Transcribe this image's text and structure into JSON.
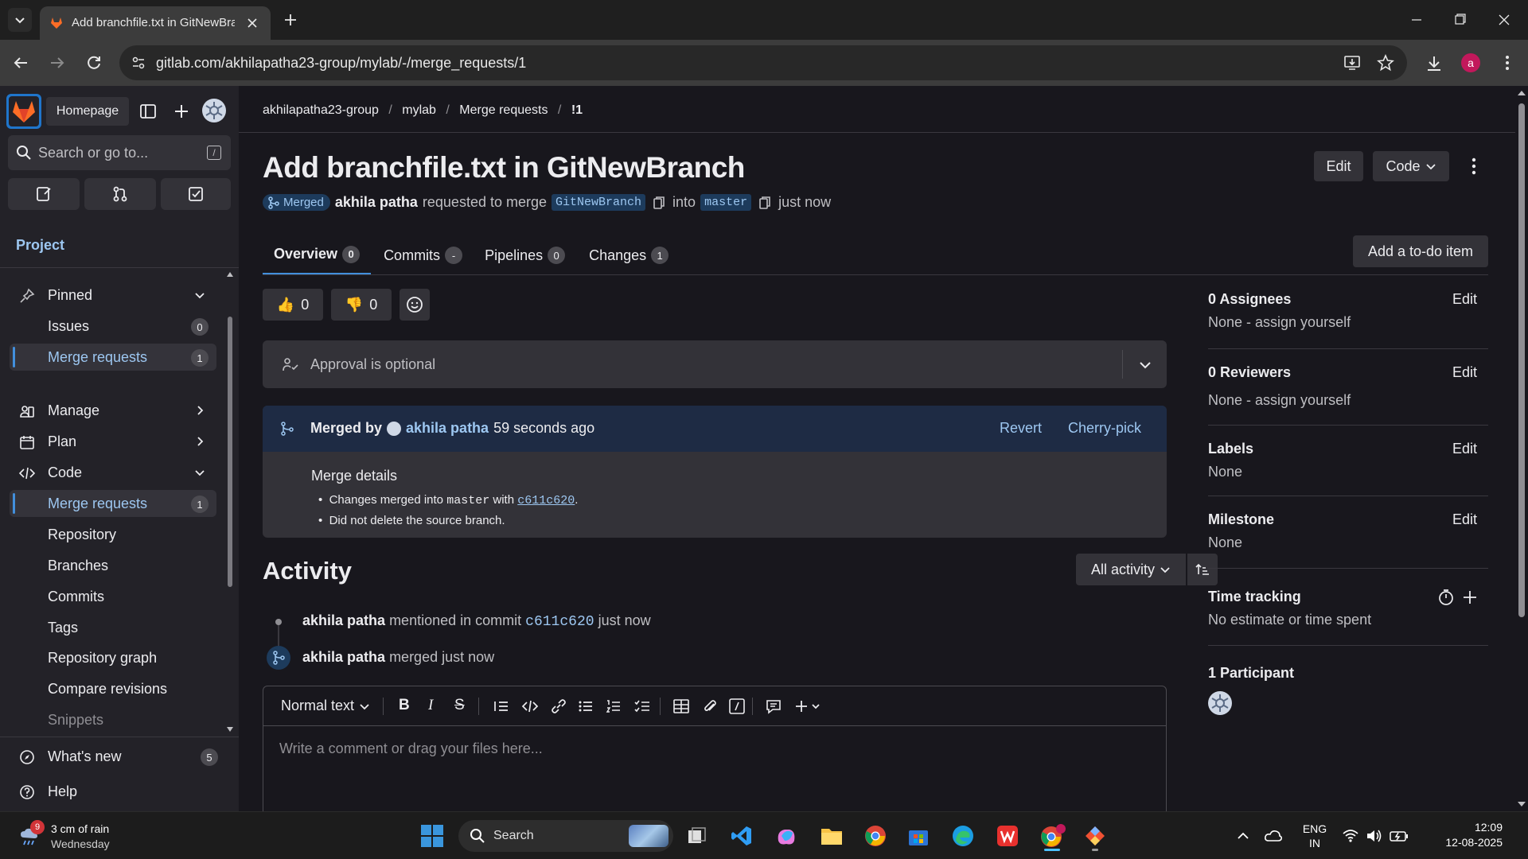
{
  "browser": {
    "tab_title": "Add branchfile.txt in GitNewBra",
    "url": "gitlab.com/akhilapatha23-group/mylab/-/merge_requests/1",
    "profile_initial": "a"
  },
  "sidebar": {
    "homepage_label": "Homepage",
    "search_placeholder": "Search or go to...",
    "search_shortcut": "/",
    "context_label": "Project",
    "items": {
      "pinned": "Pinned",
      "issues": "Issues",
      "issues_count": "0",
      "pinned_mr": "Merge requests",
      "pinned_mr_count": "1",
      "manage": "Manage",
      "plan": "Plan",
      "code": "Code",
      "code_mr": "Merge requests",
      "code_mr_count": "1",
      "repository": "Repository",
      "branches": "Branches",
      "commits": "Commits",
      "tags": "Tags",
      "repo_graph": "Repository graph",
      "compare": "Compare revisions",
      "snippets": "Snippets"
    },
    "whats_new": "What's new",
    "whats_new_count": "5",
    "help": "Help"
  },
  "breadcrumb": {
    "group": "akhilapatha23-group",
    "project": "mylab",
    "section": "Merge requests",
    "current": "!1"
  },
  "mr": {
    "title": "Add branchfile.txt in GitNewBranch",
    "status": "Merged",
    "author": "akhila patha",
    "requested_text": "requested to merge",
    "source_branch": "GitNewBranch",
    "into_text": "into",
    "target_branch": "master",
    "time": "just now",
    "edit_label": "Edit",
    "code_label": "Code"
  },
  "tabs": [
    {
      "label": "Overview",
      "count": "0"
    },
    {
      "label": "Commits",
      "count": "-"
    },
    {
      "label": "Pipelines",
      "count": "0"
    },
    {
      "label": "Changes",
      "count": "1"
    }
  ],
  "todo_label": "Add a to-do item",
  "reactions": {
    "thumbs_up": "0",
    "thumbs_down": "0"
  },
  "approval": {
    "text": "Approval is optional"
  },
  "merged_widget": {
    "merged_by": "Merged by",
    "user": "akhila patha",
    "when": "59 seconds ago",
    "revert": "Revert",
    "cherry_pick": "Cherry-pick",
    "details_title": "Merge details",
    "line1_a": "Changes merged into",
    "line1_branch": "master",
    "line1_with": "with",
    "line1_commit": "c611c620",
    "line1_end": ".",
    "line2": "Did not delete the source branch."
  },
  "activity": {
    "title": "Activity",
    "filter": "All activity",
    "items": [
      {
        "user": "akhila patha",
        "text": "mentioned in commit",
        "commit": "c611c620",
        "time": "just now"
      },
      {
        "user": "akhila patha",
        "text": "merged just now"
      }
    ]
  },
  "editor": {
    "format": "Normal text",
    "placeholder": "Write a comment or drag your files here..."
  },
  "right_sidebar": {
    "assignees_title": "0 Assignees",
    "assignees_value": "None - assign yourself",
    "reviewers_title": "0 Reviewers",
    "reviewers_value": "None - assign yourself",
    "labels_title": "Labels",
    "labels_value": "None",
    "milestone_title": "Milestone",
    "milestone_value": "None",
    "time_title": "Time tracking",
    "time_value": "No estimate or time spent",
    "participants_title": "1 Participant",
    "edit": "Edit"
  },
  "taskbar": {
    "weather_badge": "9",
    "weather_line1": "3 cm of rain",
    "weather_line2": "Wednesday",
    "search": "Search",
    "lang1": "ENG",
    "lang2": "IN",
    "time": "12:09",
    "date": "12-08-2025"
  },
  "colors": {
    "accent": "#428fdc",
    "merged_badge": "#1d3b5c",
    "gitlab_orange": "#fc6d26"
  }
}
